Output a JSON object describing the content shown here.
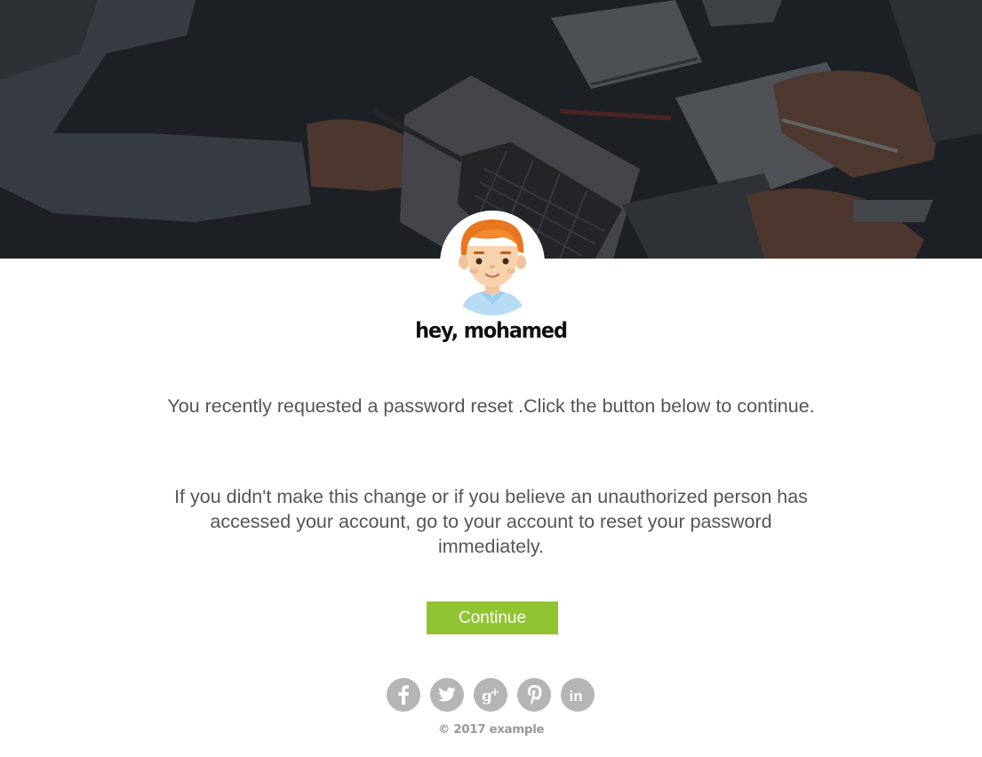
{
  "email": {
    "greeting": "hey, mohamed",
    "paragraph_1": "You recently requested a password reset .Click the button below to continue.",
    "paragraph_2": "If you didn't make this change or if you believe an unauthorized person has accessed your account, go to your account to reset your password immediately.",
    "button_label": "Continue",
    "footer": "© 2017 example"
  },
  "social_icons": [
    "facebook-icon",
    "twitter-icon",
    "google-plus-icon",
    "pinterest-icon",
    "linkedin-icon"
  ],
  "colors": {
    "button": "#90c431",
    "body_text": "#555555",
    "social_icon_bg": "#b5b5b5",
    "footer_text": "#9a9a9a"
  }
}
